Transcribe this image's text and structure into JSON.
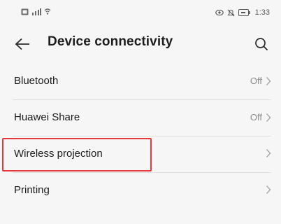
{
  "status_bar": {
    "left_icons": [
      "sim-card-icon",
      "signal-icon",
      "wifi-icon"
    ],
    "right_icons": [
      "eye-comfort-icon",
      "silent-icon",
      "battery-icon"
    ],
    "time": "1:33"
  },
  "header": {
    "title": "Device connectivity",
    "back_icon": "back-arrow-icon",
    "search_icon": "search-icon"
  },
  "settings_items": [
    {
      "label": "Bluetooth",
      "value": "Off"
    },
    {
      "label": "Huawei Share",
      "value": "Off"
    },
    {
      "label": "Wireless projection",
      "value": ""
    },
    {
      "label": "Printing",
      "value": ""
    }
  ],
  "highlight": {
    "target": "Wireless projection",
    "color": "#e5383b"
  },
  "colors": {
    "background": "#f6f6f6",
    "text_primary": "#1b1b1b",
    "text_secondary": "#8a8a8a",
    "divider": "#dedede"
  }
}
